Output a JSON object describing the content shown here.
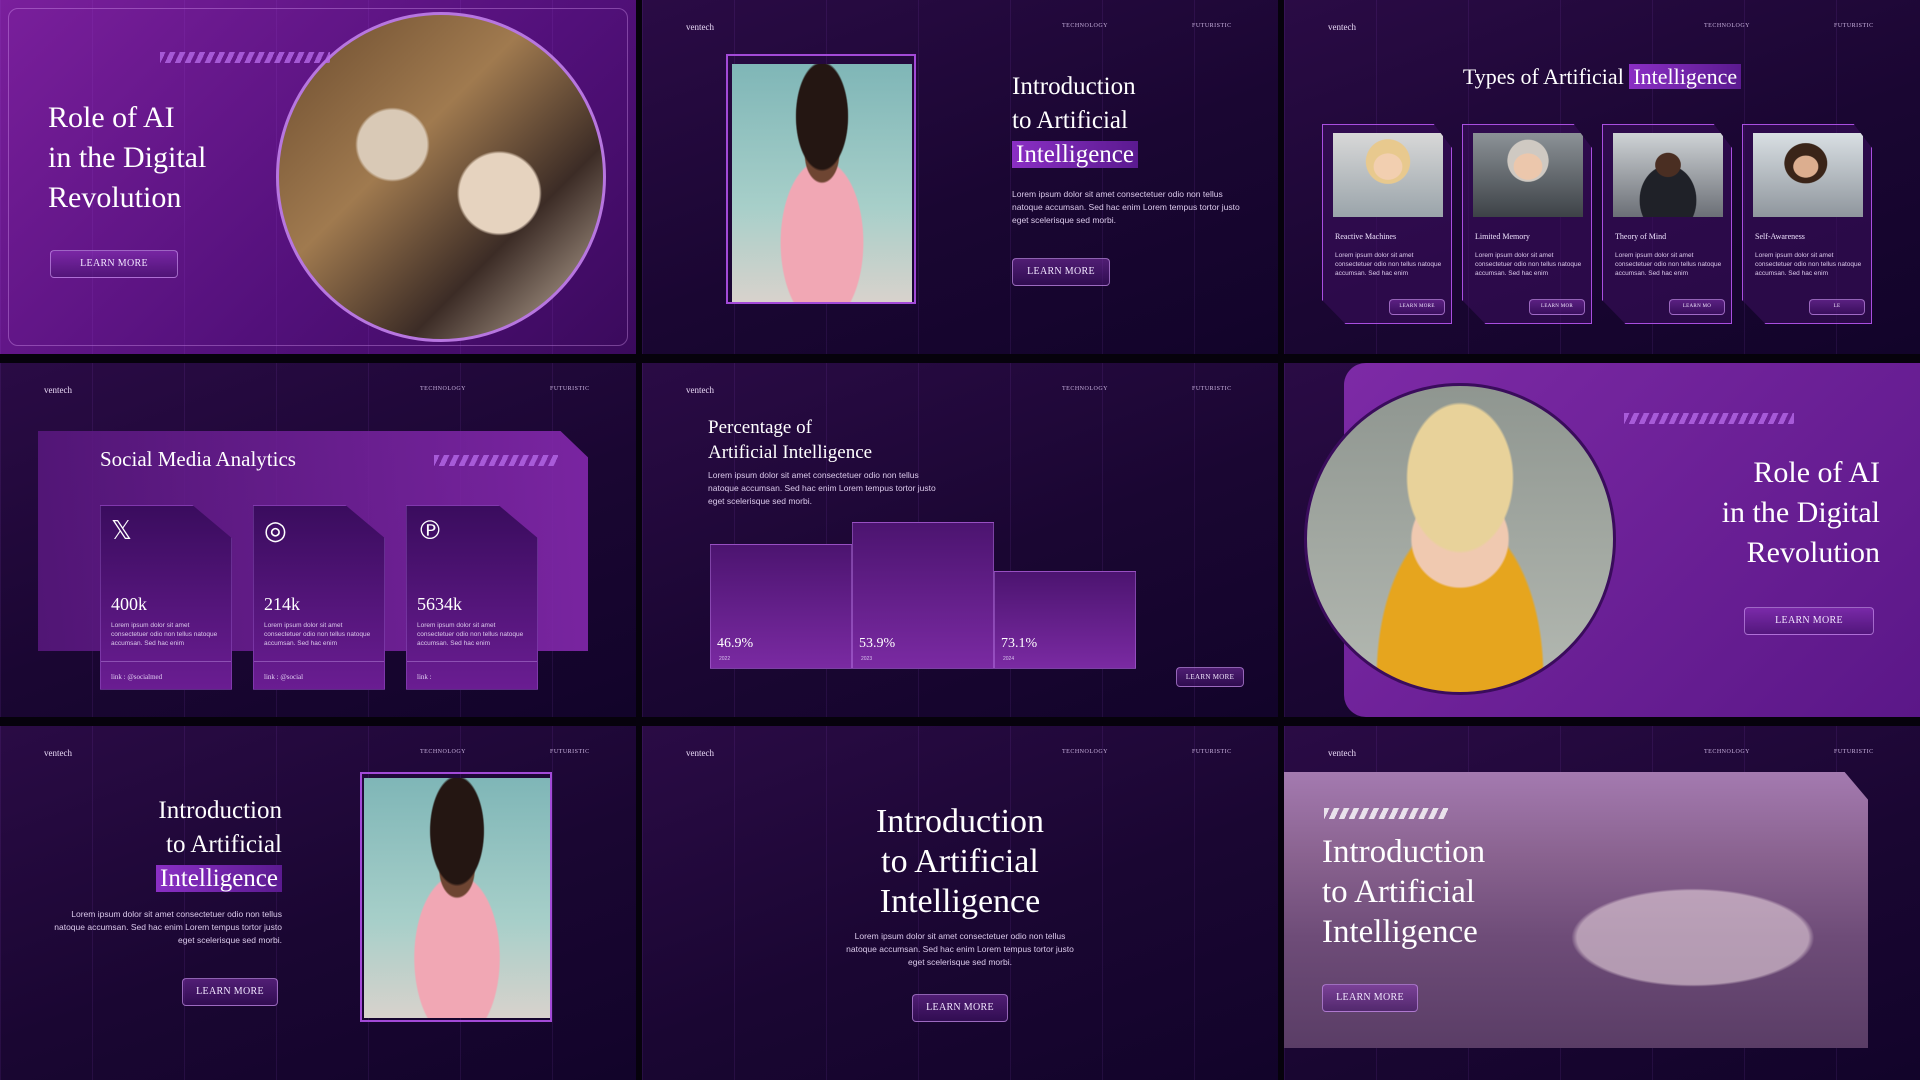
{
  "brand": "ventech",
  "nav": {
    "a": "TECHNOLOGY",
    "b": "FUTURISTIC"
  },
  "learn_more": "LEARN MORE",
  "lorem_long": "Lorem ipsum dolor sit amet consectetuer odio non tellus natoque accumsan. Sed hac enim Lorem tempus tortor justo eget scelerisque sed morbi.",
  "lorem_short": "Lorem ipsum dolor sit amet consectetuer odio non tellus natoque accumsan. Sed hac enim",
  "slide1": {
    "title_l1": "Role of AI",
    "title_l2": "in the Digital",
    "title_l3": "Revolution"
  },
  "slide2": {
    "title_l1": "Introduction",
    "title_l2": "to Artificial",
    "title_l3": "Intelligence"
  },
  "slide3": {
    "title_pre": "Types of Artificial ",
    "title_hl": "Intelligence",
    "cards": [
      {
        "title": "Reactive Machines",
        "btn": "LEARN MORE"
      },
      {
        "title": "Limited Memory",
        "btn": "LEARN MOR"
      },
      {
        "title": "Theory of Mind",
        "btn": "LEARN MO"
      },
      {
        "title": "Self-Awareness",
        "btn": "LE"
      }
    ]
  },
  "slide4": {
    "title": "Social Media Analytics",
    "cards": [
      {
        "icon": "𝕏",
        "value": "400k",
        "link": "link : @socialmed"
      },
      {
        "icon": "◎",
        "value": "214k",
        "link": "link : @social"
      },
      {
        "icon": "℗",
        "value": "5634k",
        "link": "link :"
      }
    ]
  },
  "slide5": {
    "title_l1": "Percentage of",
    "title_l2": "Artificial Intelligence"
  },
  "chart_data": {
    "type": "bar",
    "categories": [
      "2022",
      "2023",
      "2024"
    ],
    "values": [
      46.9,
      53.9,
      73.1
    ],
    "labels": [
      "46.9%",
      "53.9%",
      "73.1%"
    ]
  },
  "slide6": {
    "title_l1": "Role of AI",
    "title_l2": "in the Digital",
    "title_l3": "Revolution"
  },
  "slide7": {
    "title_l1": "Introduction",
    "title_l2": "to Artificial",
    "title_l3": "Intelligence"
  },
  "slide8": {
    "title_l1": "Introduction",
    "title_l2": "to Artificial",
    "title_l3": "Intelligence"
  },
  "slide9": {
    "title_l1": "Introduction",
    "title_l2": "to Artificial",
    "title_l3": "Intelligence"
  }
}
